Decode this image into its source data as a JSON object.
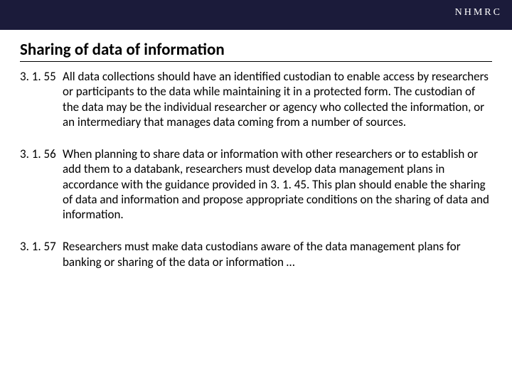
{
  "header": {
    "brand": "NHMRC"
  },
  "title": "Sharing of data of information",
  "clauses": [
    {
      "num": "3. 1. 55",
      "text": "All data collections should have an identified custodian to enable access by researchers or participants to the data while maintaining it in a protected form. The custodian of the data may be the individual researcher or agency who collected the information, or an intermediary that manages data coming from a number of sources."
    },
    {
      "num": "3. 1. 56",
      "text": "When planning to share data or information with other researchers or to establish or add them to a databank, researchers must develop data management plans in accordance with the guidance provided in 3. 1. 45. This plan should enable the sharing of data and information and propose appropriate conditions on the sharing of data and information."
    },
    {
      "num": "3. 1. 57",
      "text": "Researchers must make data custodians aware of the data management plans for banking or sharing of the data or information …"
    }
  ]
}
